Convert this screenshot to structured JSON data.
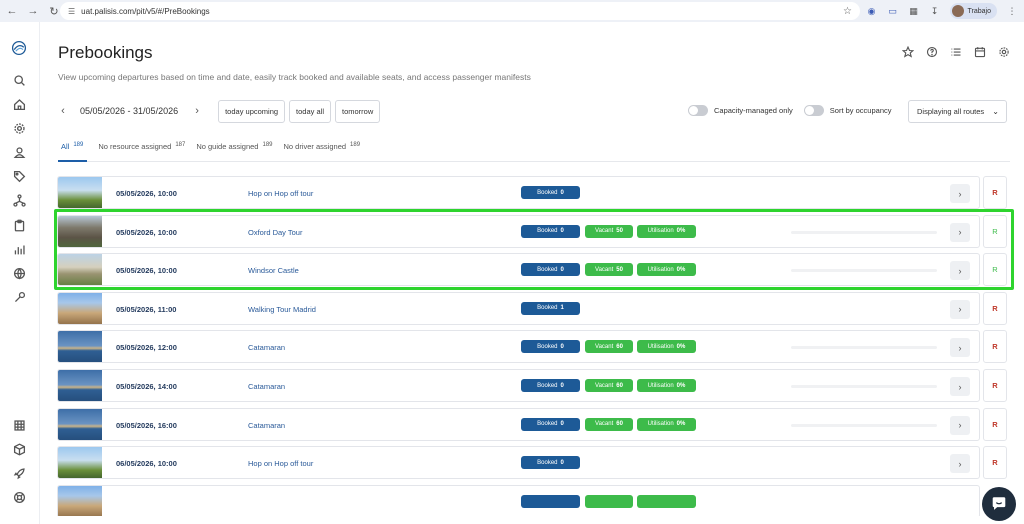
{
  "browser": {
    "url": "uat.palisis.com/pit/v5/#/PreBookings",
    "profile_name": "Trabajo"
  },
  "page": {
    "title": "Prebookings",
    "subtitle": "View upcoming departures based on time and date, easily track booked and available seats, and access passenger manifests"
  },
  "filters": {
    "date_range": "05/05/2026 - 31/05/2026",
    "quick_buttons": [
      "today upcoming",
      "today all",
      "tomorrow"
    ],
    "capacity_label": "Capacity-managed only",
    "occupancy_label": "Sort by occupancy",
    "routes_label": "Displaying all routes"
  },
  "tabs": [
    {
      "label": "All",
      "count": "189"
    },
    {
      "label": "No resource assigned",
      "count": "187"
    },
    {
      "label": "No guide assigned",
      "count": "189"
    },
    {
      "label": "No driver assigned",
      "count": "189"
    }
  ],
  "rows": [
    {
      "datetime": "05/05/2026, 10:00",
      "tour": "Hop on Hop off tour",
      "booked_label": "Booked",
      "booked": "0",
      "vacant_label": "",
      "vacant": "",
      "util_label": "",
      "util": "",
      "action": "R",
      "thumb": "hop"
    },
    {
      "datetime": "05/05/2026, 10:00",
      "tour": "Oxford Day Tour",
      "booked_label": "Booked",
      "booked": "0",
      "vacant_label": "Vacant",
      "vacant": "50",
      "util_label": "Utilisation",
      "util": "0%",
      "action": "R",
      "thumb": "oxford"
    },
    {
      "datetime": "05/05/2026, 10:00",
      "tour": "Windsor Castle",
      "booked_label": "Booked",
      "booked": "0",
      "vacant_label": "Vacant",
      "vacant": "50",
      "util_label": "Utilisation",
      "util": "0%",
      "action": "R",
      "thumb": "windsor"
    },
    {
      "datetime": "05/05/2026, 11:00",
      "tour": "Walking Tour Madrid",
      "booked_label": "Booked",
      "booked": "1",
      "vacant_label": "",
      "vacant": "",
      "util_label": "",
      "util": "",
      "action": "R",
      "thumb": "madrid"
    },
    {
      "datetime": "05/05/2026, 12:00",
      "tour": "Catamaran",
      "booked_label": "Booked",
      "booked": "0",
      "vacant_label": "Vacant",
      "vacant": "60",
      "util_label": "Utilisation",
      "util": "0%",
      "action": "R",
      "thumb": "cat"
    },
    {
      "datetime": "05/05/2026, 14:00",
      "tour": "Catamaran",
      "booked_label": "Booked",
      "booked": "0",
      "vacant_label": "Vacant",
      "vacant": "60",
      "util_label": "Utilisation",
      "util": "0%",
      "action": "R",
      "thumb": "cat"
    },
    {
      "datetime": "05/05/2026, 16:00",
      "tour": "Catamaran",
      "booked_label": "Booked",
      "booked": "0",
      "vacant_label": "Vacant",
      "vacant": "60",
      "util_label": "Utilisation",
      "util": "0%",
      "action": "R",
      "thumb": "cat"
    },
    {
      "datetime": "06/05/2026, 10:00",
      "tour": "Hop on Hop off tour",
      "booked_label": "Booked",
      "booked": "0",
      "vacant_label": "",
      "vacant": "",
      "util_label": "",
      "util": "",
      "action": "R",
      "thumb": "hop"
    },
    {
      "datetime": "",
      "tour": "",
      "booked_label": "",
      "booked": "",
      "vacant_label": "",
      "vacant": "",
      "util_label": "",
      "util": "",
      "action": "",
      "thumb": "madrid"
    }
  ],
  "colors": {
    "booked": "#1d5a97",
    "vacant": "#3dbb4a",
    "highlight": "#2ed42e",
    "link": "#2a5a99"
  }
}
